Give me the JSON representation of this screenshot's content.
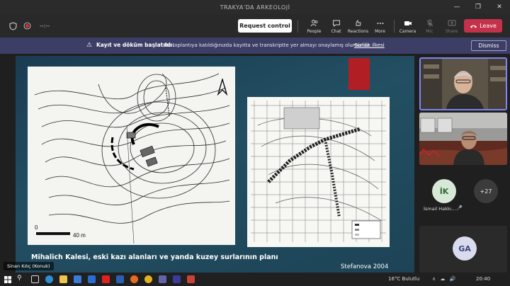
{
  "window": {
    "title": "TRAKYA'DA ARKEOLOJİ"
  },
  "toolbar": {
    "timer": "--:--",
    "request_control": "Request control",
    "items": [
      {
        "label": "People",
        "icon": "people-icon"
      },
      {
        "label": "Chat",
        "icon": "chat-icon"
      },
      {
        "label": "Reactions",
        "icon": "reactions-icon"
      },
      {
        "label": "More",
        "icon": "more-icon"
      }
    ],
    "device_items": [
      {
        "label": "Camera",
        "icon": "camera-icon"
      },
      {
        "label": "Mic",
        "icon": "mic-icon"
      },
      {
        "label": "Share",
        "icon": "share-icon"
      }
    ],
    "leave": "Leave"
  },
  "banner": {
    "title": "Kayıt ve döküm başlatıldı.",
    "message": "Bu toplantıya katıldığınızda kayıtta ve transkriptte yer almayı onaylamış olursunuz.",
    "link": "Gizlilik ilkesi",
    "dismiss": "Dismiss"
  },
  "slide": {
    "caption": "Mihalich Kalesi, eski kazı alanları ve yanda kuzey surlarının planı",
    "credit": "Stefanova 2004",
    "scale_start": "0",
    "scale_end": "40 m"
  },
  "presenter": {
    "name": "Sinan Kılıç (Konuk)"
  },
  "participants": {
    "ik_initials": "İK",
    "ik_name": "İsmail Hakkı...",
    "more_count": "+27",
    "ga_initials": "GA"
  },
  "taskbar": {
    "weather": "16°C  Bulutlu",
    "time": "20:40"
  },
  "colors": {
    "accent": "#7f85f5",
    "leave": "#c4314b",
    "banner": "#3d3e66"
  }
}
